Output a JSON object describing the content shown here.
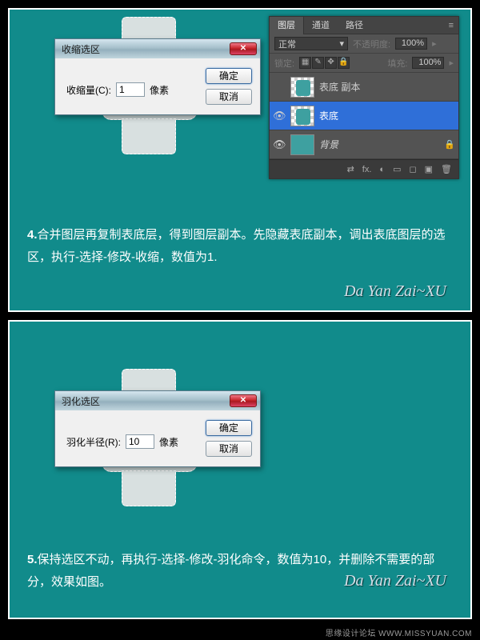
{
  "top": {
    "dialog": {
      "title": "收缩选区",
      "field_label": "收缩量(C):",
      "value": "1",
      "unit": "像素",
      "ok": "确定",
      "cancel": "取消"
    },
    "layers_panel": {
      "tabs": [
        "图层",
        "通道",
        "路径"
      ],
      "blend_mode": "正常",
      "opacity_label": "不透明度:",
      "opacity": "100%",
      "lock_label": "锁定:",
      "fill_label": "填充:",
      "fill": "100%",
      "layers": [
        {
          "visible": false,
          "name": "表底 副本",
          "selected": false,
          "thumb": "shape",
          "italic": false
        },
        {
          "visible": true,
          "name": "表底",
          "selected": true,
          "thumb": "shape",
          "italic": false
        },
        {
          "visible": true,
          "name": "背景",
          "selected": false,
          "thumb": "solid",
          "italic": true
        }
      ],
      "foot_icons": [
        "fx.",
        "◐",
        "▭",
        "◻",
        "▣",
        "🗑"
      ]
    },
    "step_num": "4.",
    "step_text": "合并图层再复制表底层，得到图层副本。先隐藏表底副本，调出表底图层的选区，执行-选择-修改-收缩，数值为1.",
    "signature": "Da Yan Zai~XU"
  },
  "bottom": {
    "dialog": {
      "title": "羽化选区",
      "field_label": "羽化半径(R):",
      "value": "10",
      "unit": "像素",
      "ok": "确定",
      "cancel": "取消"
    },
    "step_num": "5.",
    "step_text": "保持选区不动，再执行-选择-修改-羽化命令，数值为10，并删除不需要的部分，效果如图。",
    "signature": "Da Yan Zai~XU"
  },
  "footer": "思缘设计论坛  WWW.MISSYUAN.COM"
}
